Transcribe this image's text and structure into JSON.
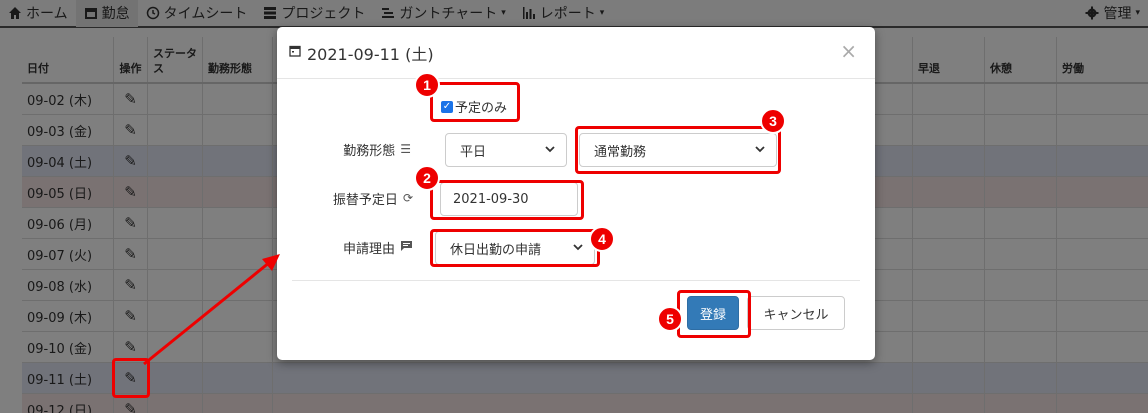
{
  "nav": {
    "items": [
      {
        "label": "ホーム",
        "icon": "home-icon"
      },
      {
        "label": "勤怠",
        "icon": "calendar-icon"
      },
      {
        "label": "タイムシート",
        "icon": "clock-icon"
      },
      {
        "label": "プロジェクト",
        "icon": "server-icon"
      },
      {
        "label": "ガントチャート",
        "icon": "list-icon",
        "caret": "▾"
      },
      {
        "label": "レポート",
        "icon": "bar-chart-icon",
        "caret": "▾"
      }
    ],
    "admin": {
      "label": "管理",
      "icon": "gear-icon",
      "caret": "▾"
    }
  },
  "table": {
    "headers": {
      "date": "日付",
      "op": "操作",
      "status": "ステータス",
      "kind": "勤務形態",
      "early": "早退",
      "break": "休憩",
      "work": "労働"
    },
    "rows": [
      {
        "date": "09-02 (木)",
        "type": "weekday"
      },
      {
        "date": "09-03 (金)",
        "type": "weekday"
      },
      {
        "date": "09-04 (土)",
        "type": "sat"
      },
      {
        "date": "09-05 (日)",
        "type": "sun"
      },
      {
        "date": "09-06 (月)",
        "type": "weekday"
      },
      {
        "date": "09-07 (火)",
        "type": "weekday"
      },
      {
        "date": "09-08 (水)",
        "type": "weekday"
      },
      {
        "date": "09-09 (木)",
        "type": "weekday"
      },
      {
        "date": "09-10 (金)",
        "type": "weekday"
      },
      {
        "date": "09-11 (土)",
        "type": "sat"
      },
      {
        "date": "09-12 (日)",
        "type": "sun"
      }
    ]
  },
  "modal": {
    "title": "2021-09-11 (土)",
    "close": "×",
    "checkbox_label": "予定のみ",
    "work_type_label": "勤務形態",
    "work_type_value": "平日",
    "work_pattern_value": "通常勤務",
    "transfer_label": "振替予定日",
    "transfer_value": "2021-09-30",
    "reason_label": "申請理由",
    "reason_value": "休日出勤の申請",
    "submit": "登録",
    "cancel": "キャンセル"
  },
  "annotations": [
    "1",
    "2",
    "3",
    "4",
    "5"
  ],
  "colors": {
    "annotation": "#e00000",
    "primary": "#337ab7",
    "saturday": "#e2e6f5",
    "sunday": "#f5e4e4"
  }
}
